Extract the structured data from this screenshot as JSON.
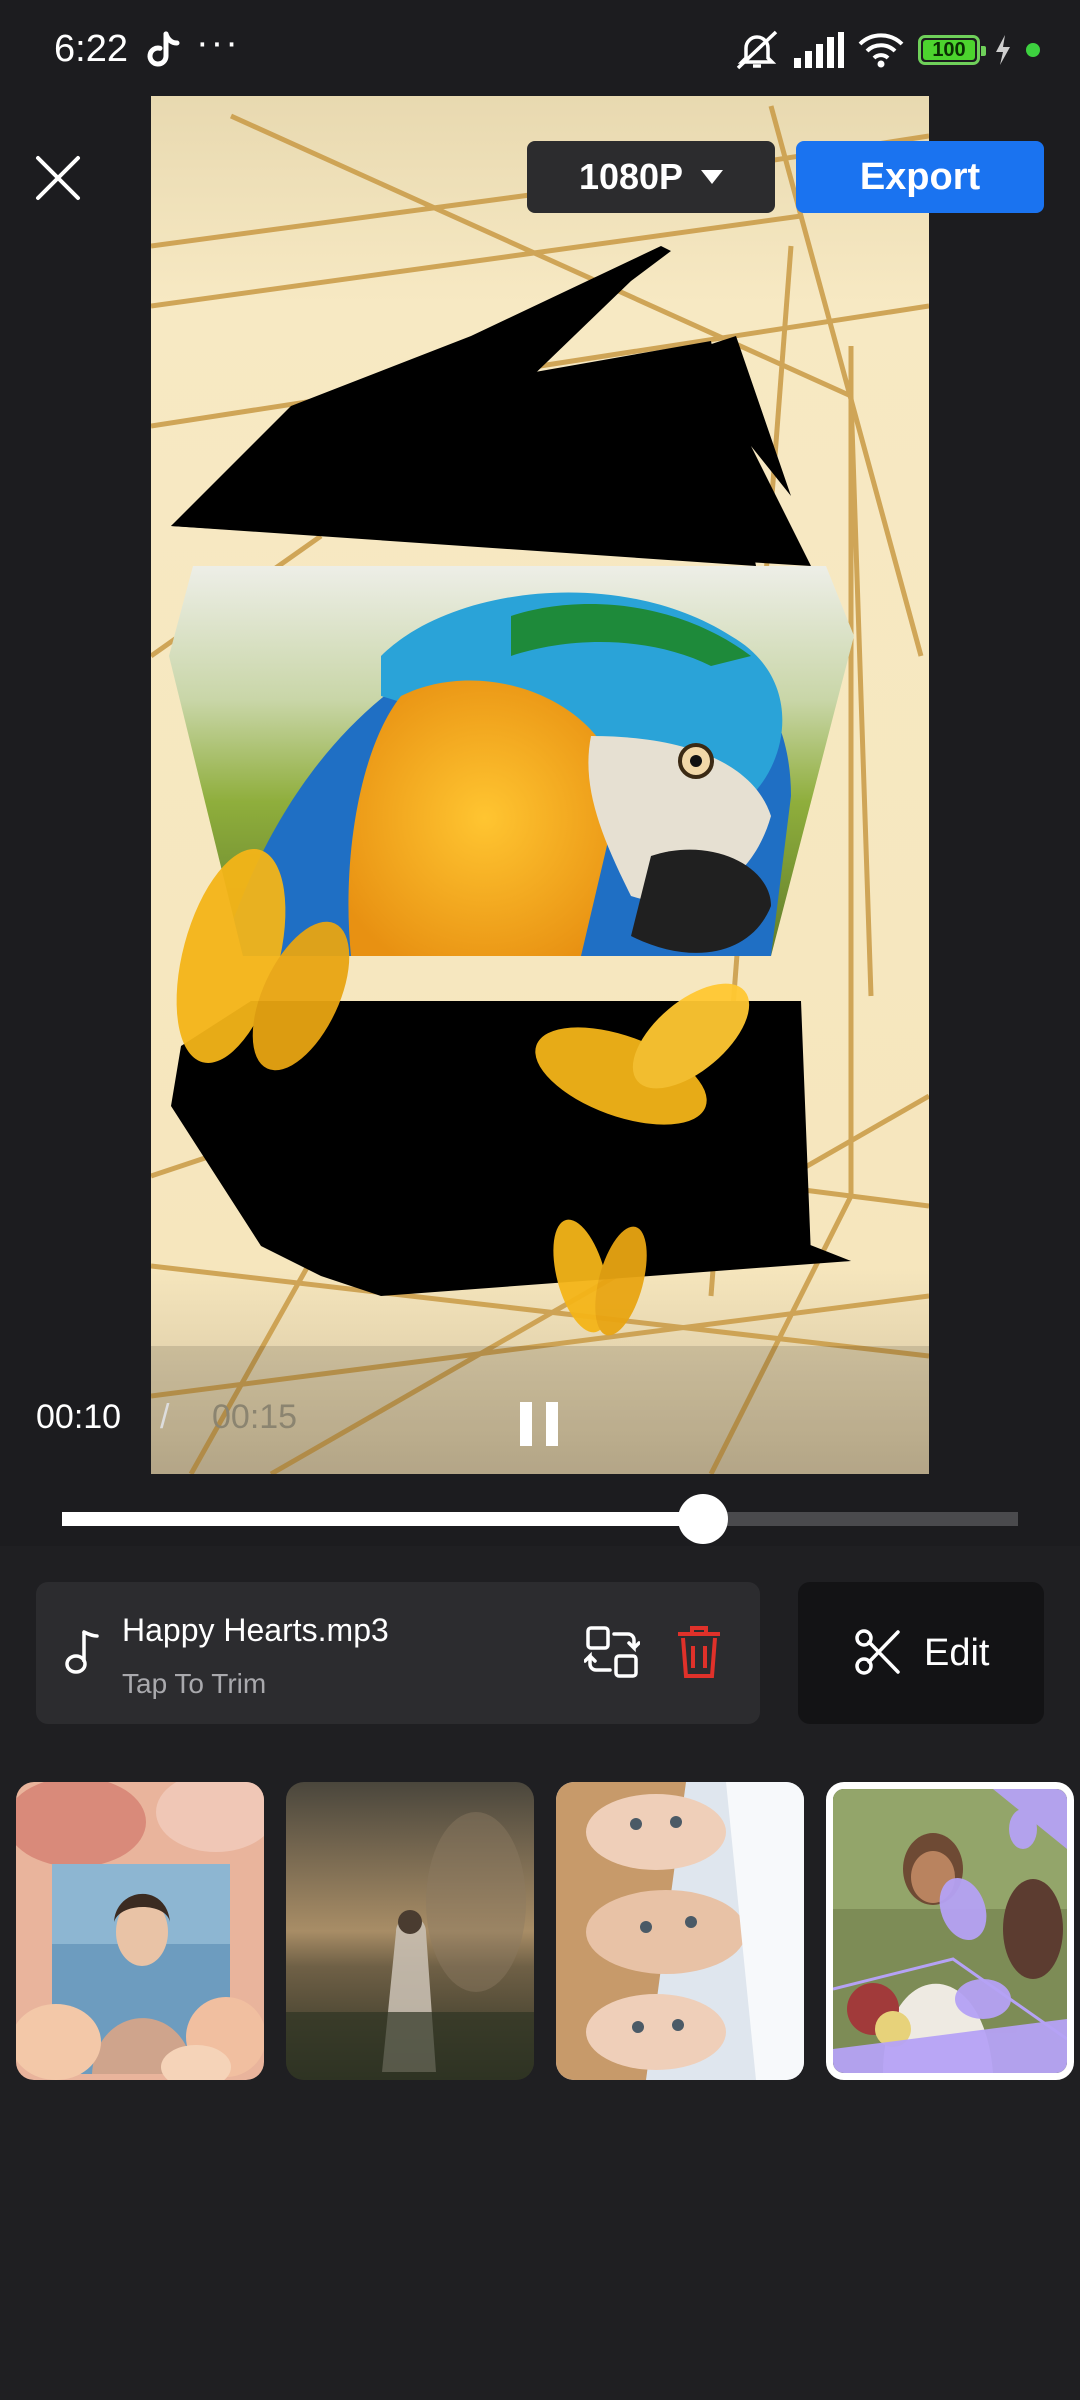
{
  "status_bar": {
    "time": "6:22",
    "dots": "···",
    "battery": "100",
    "accent_green": "#4cd42e"
  },
  "toolbar": {
    "resolution": "1080P",
    "export_label": "Export",
    "export_color": "#1a73f0"
  },
  "player": {
    "current_time": "00:10",
    "separator": "/",
    "total_time": "00:15",
    "progress": 0.67
  },
  "music": {
    "title": "Happy Hearts.mp3",
    "subtitle": "Tap To Trim",
    "delete_color": "#e0312a"
  },
  "edit": {
    "label": "Edit"
  },
  "templates": [
    {
      "name": "pink-flowers-portrait",
      "selected": false
    },
    {
      "name": "field-woman-dusk",
      "selected": false
    },
    {
      "name": "three-faces",
      "selected": false
    },
    {
      "name": "bride-purple-butterflies",
      "selected": true
    }
  ]
}
